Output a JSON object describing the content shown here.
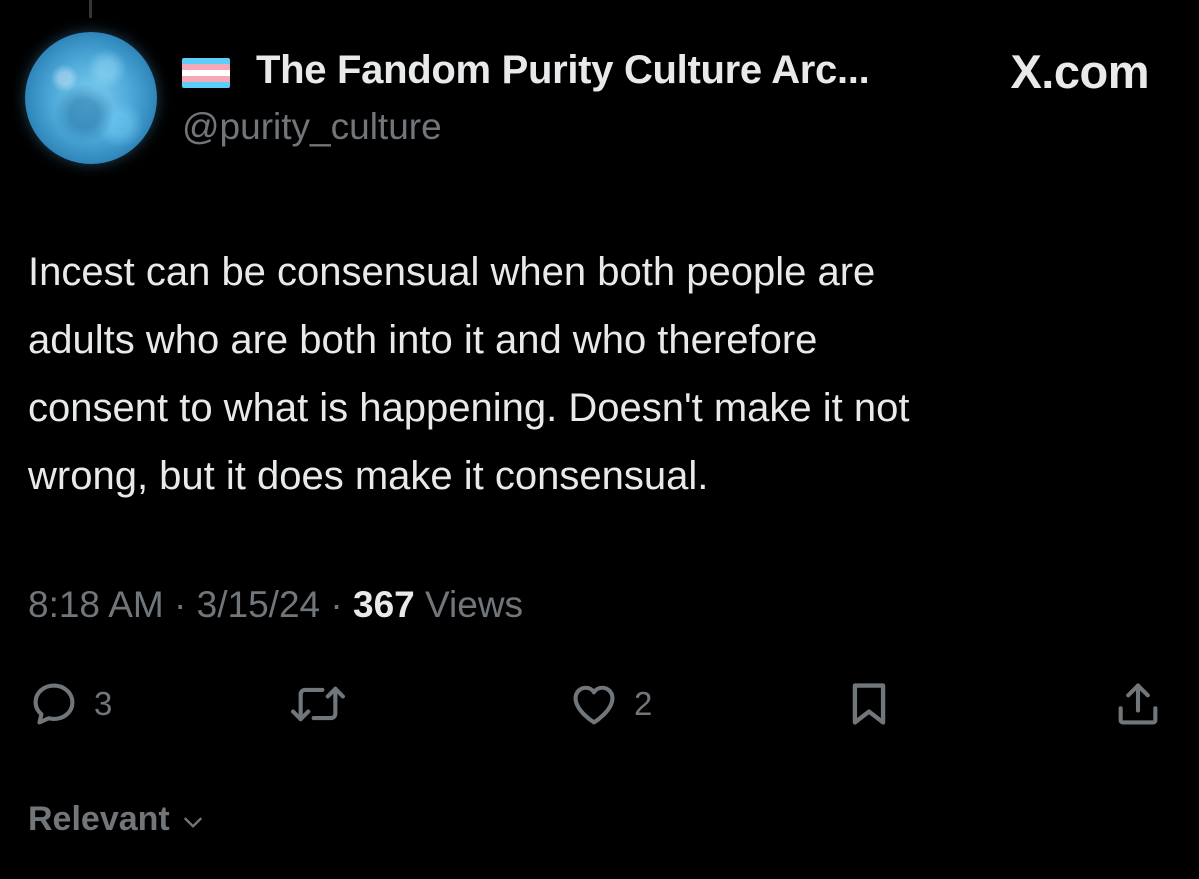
{
  "author": {
    "display_name": "The Fandom Purity Culture Arc...",
    "handle": "@purity_culture",
    "flag_icon": "transgender-flag-icon",
    "avatar": "blue-moon-avatar"
  },
  "site_label": "X.com",
  "tweet": {
    "text": "Incest can be consensual when both people are\nadults who are both into it and who therefore\nconsent to what is happening. Doesn't make it not\nwrong, but it does make it consensual.",
    "time": "8:18 AM",
    "separator": "·",
    "date": "3/15/24",
    "views_count": "367",
    "views_label": "Views"
  },
  "actions": {
    "reply_icon": "reply-icon",
    "reply_count": "3",
    "retweet_icon": "retweet-icon",
    "like_icon": "heart-icon",
    "like_count": "2",
    "bookmark_icon": "bookmark-icon",
    "share_icon": "share-icon"
  },
  "replies_sort": {
    "label": "Relevant",
    "icon": "chevron-down-icon"
  },
  "colors": {
    "background": "#000000",
    "primary_text": "#e7e9ea",
    "secondary_text": "#71767b",
    "flag_blue": "#5bcefa",
    "flag_pink": "#f5a9b8",
    "flag_white": "#ffffff"
  }
}
